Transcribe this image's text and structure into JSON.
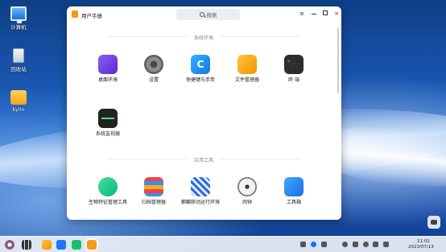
{
  "desktop": {
    "icons": [
      {
        "label": "计算机",
        "icon": "computer-icon"
      },
      {
        "label": "回收站",
        "icon": "trash-icon"
      },
      {
        "label": "kylin",
        "icon": "folder-icon"
      }
    ]
  },
  "window": {
    "title": "用户手册",
    "search_placeholder": "搜索",
    "controls": {
      "menu": "≡",
      "close": "×"
    },
    "sections": [
      {
        "title": "系统环境",
        "apps": [
          {
            "label": "桌面环境",
            "icon": "desktop-environment-icon"
          },
          {
            "label": "设置",
            "icon": "settings-gear-icon"
          },
          {
            "label": "快捷键与手势",
            "icon": "shortcut-icon"
          },
          {
            "label": "文件管理器",
            "icon": "file-manager-icon"
          },
          {
            "label": "终 端",
            "icon": "terminal-icon"
          },
          {
            "label": "系统监视器",
            "icon": "system-monitor-icon"
          }
        ]
      },
      {
        "title": "应用工具",
        "apps": [
          {
            "label": "生物特征管理工具",
            "icon": "biometric-icon"
          },
          {
            "label": "归档管理器",
            "icon": "archive-manager-icon"
          },
          {
            "label": "麒麟移动运行环境",
            "icon": "mobile-runtime-icon"
          },
          {
            "label": "闹钟",
            "icon": "clock-icon"
          },
          {
            "label": "工具箱",
            "icon": "toolbox-icon"
          }
        ]
      }
    ]
  },
  "taskbar": {
    "time": "11:02",
    "date": "2023/07/13",
    "apps": [
      "start-menu-icon",
      "multitask-icon",
      "file-manager-icon",
      "wps-icon",
      "green-app-icon",
      "user-manual-icon"
    ]
  }
}
